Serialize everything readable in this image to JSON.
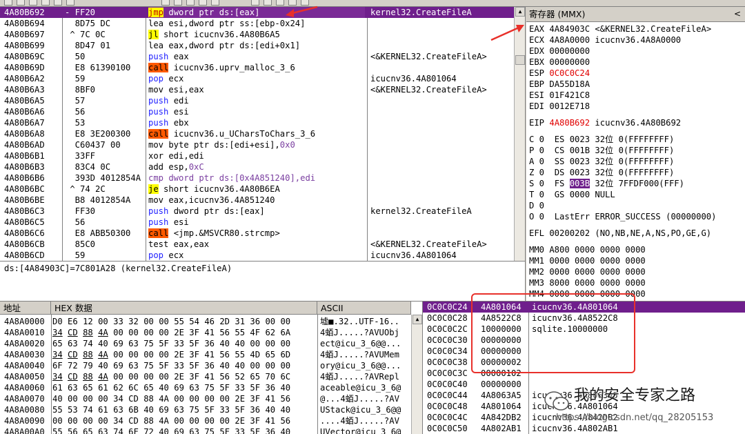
{
  "toolbar": {
    "buttons": 16
  },
  "cpu": {
    "rows": [
      {
        "addr": "4A80B692",
        "hex": "- FF20",
        "asm": [
          {
            "t": "jmp",
            "c": "kw-jmp"
          },
          {
            "t": " dword ptr ds:[eax]"
          }
        ],
        "cmt": "kernel32.CreateFileA",
        "selected": true
      },
      {
        "addr": "4A80B694",
        "hex": "  8D75 DC",
        "asm": [
          {
            "t": "lea esi,dword ptr ss:[ebp-0x24]"
          }
        ],
        "cmt": ""
      },
      {
        "addr": "4A80B697",
        "hex": " ^ 7C 0C",
        "asm": [
          {
            "t": "jl",
            "c": "jcc"
          },
          {
            "t": " short icucnv36.4A80B6A5"
          }
        ],
        "cmt": ""
      },
      {
        "addr": "4A80B699",
        "hex": "  8D47 01",
        "asm": [
          {
            "t": "lea eax,dword ptr ds:[edi+0x1]"
          }
        ],
        "cmt": ""
      },
      {
        "addr": "4A80B69C",
        "hex": "  50",
        "asm": [
          {
            "t": "push",
            "c": "kw-push"
          },
          {
            "t": " eax"
          }
        ],
        "cmt": "<&KERNEL32.CreateFileA>"
      },
      {
        "addr": "4A80B69D",
        "hex": "  E8 61390100",
        "asm": [
          {
            "t": "call",
            "c": "kw-call"
          },
          {
            "t": " icucnv36.uprv_malloc_3_6"
          }
        ],
        "cmt": ""
      },
      {
        "addr": "4A80B6A2",
        "hex": "  59",
        "asm": [
          {
            "t": "pop",
            "c": "kw-pop"
          },
          {
            "t": " ecx"
          }
        ],
        "cmt": "icucnv36.4A801064"
      },
      {
        "addr": "4A80B6A3",
        "hex": "  8BF0",
        "asm": [
          {
            "t": "mov esi,eax"
          }
        ],
        "cmt": "<&KERNEL32.CreateFileA>"
      },
      {
        "addr": "4A80B6A5",
        "hex": "  57",
        "asm": [
          {
            "t": "push",
            "c": "kw-push"
          },
          {
            "t": " edi"
          }
        ],
        "cmt": ""
      },
      {
        "addr": "4A80B6A6",
        "hex": "  56",
        "asm": [
          {
            "t": "push",
            "c": "kw-push"
          },
          {
            "t": " esi"
          }
        ],
        "cmt": ""
      },
      {
        "addr": "4A80B6A7",
        "hex": "  53",
        "asm": [
          {
            "t": "push",
            "c": "kw-push"
          },
          {
            "t": " ebx"
          }
        ],
        "cmt": ""
      },
      {
        "addr": "4A80B6A8",
        "hex": "  E8 3E200300",
        "asm": [
          {
            "t": "call",
            "c": "kw-call"
          },
          {
            "t": " icucnv36.u_UCharsToChars_3_6"
          }
        ],
        "cmt": ""
      },
      {
        "addr": "4A80B6AD",
        "hex": "  C60437 00",
        "asm": [
          {
            "t": "mov byte ptr ds:[edi+esi],"
          },
          {
            "t": "0x0",
            "c": "imm"
          }
        ],
        "cmt": ""
      },
      {
        "addr": "4A80B6B1",
        "hex": "  33FF",
        "asm": [
          {
            "t": "xor edi,edi"
          }
        ],
        "cmt": ""
      },
      {
        "addr": "4A80B6B3",
        "hex": "  83C4 0C",
        "asm": [
          {
            "t": "add esp,"
          },
          {
            "t": "0xC",
            "c": "imm"
          }
        ],
        "cmt": ""
      },
      {
        "addr": "4A80B6B6",
        "hex": "  393D 4012854A",
        "asm": [
          {
            "t": "cmp dword ptr ds:[0x4A851240],edi",
            "c": "imm"
          }
        ],
        "cmt": ""
      },
      {
        "addr": "4A80B6BC",
        "hex": " ^ 74 2C",
        "asm": [
          {
            "t": "je",
            "c": "jcc"
          },
          {
            "t": " short icucnv36.4A80B6EA"
          }
        ],
        "cmt": ""
      },
      {
        "addr": "4A80B6BE",
        "hex": "  B8 4012854A",
        "asm": [
          {
            "t": "mov eax,icucnv36.4A851240"
          }
        ],
        "cmt": ""
      },
      {
        "addr": "4A80B6C3",
        "hex": "  FF30",
        "asm": [
          {
            "t": "push",
            "c": "kw-push"
          },
          {
            "t": " dword ptr ds:[eax]"
          }
        ],
        "cmt": "kernel32.CreateFileA"
      },
      {
        "addr": "4A80B6C5",
        "hex": "  56",
        "asm": [
          {
            "t": "push",
            "c": "kw-push"
          },
          {
            "t": " esi"
          }
        ],
        "cmt": ""
      },
      {
        "addr": "4A80B6C6",
        "hex": "  E8 ABB50300",
        "asm": [
          {
            "t": "call",
            "c": "kw-call"
          },
          {
            "t": " <jmp.&MSVCR80.strcmp>"
          }
        ],
        "cmt": ""
      },
      {
        "addr": "4A80B6CB",
        "hex": "  85C0",
        "asm": [
          {
            "t": "test eax,eax"
          }
        ],
        "cmt": "<&KERNEL32.CreateFileA>"
      },
      {
        "addr": "4A80B6CD",
        "hex": "  59",
        "asm": [
          {
            "t": "pop",
            "c": "kw-pop"
          },
          {
            "t": " ecx"
          }
        ],
        "cmt": "icucnv36.4A801064"
      }
    ]
  },
  "info": {
    "line": "ds:[4A84903C]=7C801A28 (kernel32.CreateFileA)"
  },
  "registers": {
    "title": "寄存器 (MMX)",
    "close": "<",
    "gp": [
      {
        "name": "EAX",
        "val": "4A84903C",
        "cmt": "<&KERNEL32.CreateFileA>",
        "red": false
      },
      {
        "name": "ECX",
        "val": "4A8A0000",
        "cmt": "icucnv36.4A8A0000",
        "red": false
      },
      {
        "name": "EDX",
        "val": "00000000",
        "cmt": "",
        "red": false
      },
      {
        "name": "EBX",
        "val": "00000000",
        "cmt": "",
        "red": false
      },
      {
        "name": "ESP",
        "val": "0C0C0C24",
        "cmt": "",
        "red": true
      },
      {
        "name": "EBP",
        "val": "DA55D18A",
        "cmt": "",
        "red": false
      },
      {
        "name": "ESI",
        "val": "01F421C8",
        "cmt": "",
        "red": false
      },
      {
        "name": "EDI",
        "val": "0012E718",
        "cmt": "",
        "red": false
      }
    ],
    "eip": {
      "name": "EIP",
      "val": "4A80B692",
      "cmt": "icucnv36.4A80B692"
    },
    "flags": [
      {
        "f": "C 0",
        "seg": "ES 0023 32位 0(FFFFFFFF)"
      },
      {
        "f": "P 0",
        "seg": "CS 001B 32位 0(FFFFFFFF)"
      },
      {
        "f": "A 0",
        "seg": "SS 0023 32位 0(FFFFFFFF)"
      },
      {
        "f": "Z 0",
        "seg": "DS 0023 32位 0(FFFFFFFF)"
      },
      {
        "f": "S 0",
        "seg": "FS ",
        "segHl": "003B",
        "segRest": " 32位 7FFDF000(FFF)"
      },
      {
        "f": "T 0",
        "seg": "GS 0000 NULL"
      },
      {
        "f": "D 0",
        "seg": ""
      },
      {
        "f": "O 0",
        "seg": "LastErr ERROR_SUCCESS (00000000)"
      }
    ],
    "efl": "EFL 00200202 (NO,NB,NE,A,NS,PO,GE,G)",
    "mm": [
      "MM0 A800 0000 0000 0000",
      "MM1 0000 0000 0000 0000",
      "MM2 0000 0000 0000 0000",
      "MM3 8000 0000 0000 0000",
      "MM4 0000 0000 0000 0000"
    ]
  },
  "dump": {
    "headers": {
      "addr": "地址",
      "hex": "HEX 数据",
      "ascii": "ASCII"
    },
    "rows": [
      {
        "a": "4A8A0000",
        "h": "D0 E6 12 00 33 32 00 00 55 54 46 2D 31 36 00 00",
        "s": "墟■.32..UTF-16.."
      },
      {
        "a": "4A8A0010",
        "h": "34 CD 88 4A 00 00 00 00 2E 3F 41 56 55 4F 62 6A",
        "s": "4蛨J.....?AVUObj",
        "u": true
      },
      {
        "a": "4A8A0020",
        "h": "65 63 74 40 69 63 75 5F 33 5F 36 40 40 00 00 00",
        "s": "ect@icu_3_6@@..."
      },
      {
        "a": "4A8A0030",
        "h": "34 CD 88 4A 00 00 00 00 2E 3F 41 56 55 4D 65 6D",
        "s": "4蛨J.....?AVUMem",
        "u": true
      },
      {
        "a": "4A8A0040",
        "h": "6F 72 79 40 69 63 75 5F 33 5F 36 40 40 00 00 00",
        "s": "ory@icu_3_6@@..."
      },
      {
        "a": "4A8A0050",
        "h": "34 CD 88 4A 00 00 00 00 2E 3F 41 56 52 65 70 6C",
        "s": "4蛨J.....?AVRepl",
        "u": true
      },
      {
        "a": "4A8A0060",
        "h": "61 63 65 61 62 6C 65 40 69 63 75 5F 33 5F 36 40",
        "s": "aceable@icu_3_6@"
      },
      {
        "a": "4A8A0070",
        "h": "40 00 00 00 34 CD 88 4A 00 00 00 00 2E 3F 41 56",
        "s": "@...4蛨J.....?AV"
      },
      {
        "a": "4A8A0080",
        "h": "55 53 74 61 63 6B 40 69 63 75 5F 33 5F 36 40 40",
        "s": "UStack@icu_3_6@@"
      },
      {
        "a": "4A8A0090",
        "h": "00 00 00 00 34 CD 88 4A 00 00 00 00 2E 3F 41 56",
        "s": "....4蛨J.....?AV"
      },
      {
        "a": "4A8A00A0",
        "h": "55 56 65 63 74 6F 72 40 69 63 75 5F 33 5F 36 40",
        "s": "UVector@icu_3_6@"
      }
    ]
  },
  "stack": {
    "rows": [
      {
        "a": "0C0C0C24",
        "v": "4A801064",
        "c": "icucnv36.4A801064",
        "sel": true
      },
      {
        "a": "0C0C0C28",
        "v": "4A8522C8",
        "c": "icucnv36.4A8522C8"
      },
      {
        "a": "0C0C0C2C",
        "v": "10000000",
        "c": "sqlite.10000000"
      },
      {
        "a": "0C0C0C30",
        "v": "00000000",
        "c": ""
      },
      {
        "a": "0C0C0C34",
        "v": "00000000",
        "c": ""
      },
      {
        "a": "0C0C0C38",
        "v": "00000002",
        "c": ""
      },
      {
        "a": "0C0C0C3C",
        "v": "00000102",
        "c": ""
      },
      {
        "a": "0C0C0C40",
        "v": "00000000",
        "c": ""
      },
      {
        "a": "0C0C0C44",
        "v": "4A8063A5",
        "c": "icucnv36.4A8063A5"
      },
      {
        "a": "0C0C0C48",
        "v": "4A801064",
        "c": "icucnv36.4A801064"
      },
      {
        "a": "0C0C0C4C",
        "v": "4A842DB2",
        "c": "icucnv36.4A842DB2"
      },
      {
        "a": "0C0C0C50",
        "v": "4A802AB1",
        "c": "icucnv36.4A802AB1"
      }
    ]
  },
  "watermark": {
    "title": "我的安全专家之路",
    "url": "https://blog.csdn.net/qq_28205153"
  },
  "colors": {
    "selection": "#6f1f8c",
    "call": "#ff5a00",
    "jmp": "#ffff00",
    "annotation": "#e8302a"
  }
}
